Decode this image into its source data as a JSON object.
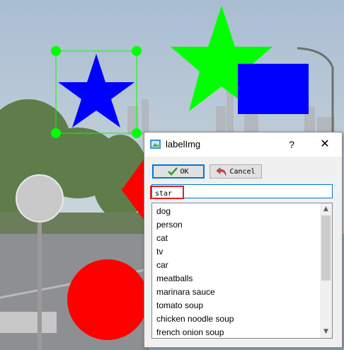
{
  "dialog": {
    "title": "labelImg",
    "help_label": "?",
    "close_label": "✕",
    "ok_label": "OK",
    "cancel_label": "Cancel",
    "label_value": "star",
    "items": [
      "dog",
      "person",
      "cat",
      "tv",
      "car",
      "meatballs",
      "marinara sauce",
      "tomato soup",
      "chicken noodle soup",
      "french onion soup"
    ]
  },
  "colors": {
    "selection": "#00ff00",
    "star_blue": "#0000ff",
    "red_shape": "#ff0000",
    "accent": "#0078d7"
  }
}
